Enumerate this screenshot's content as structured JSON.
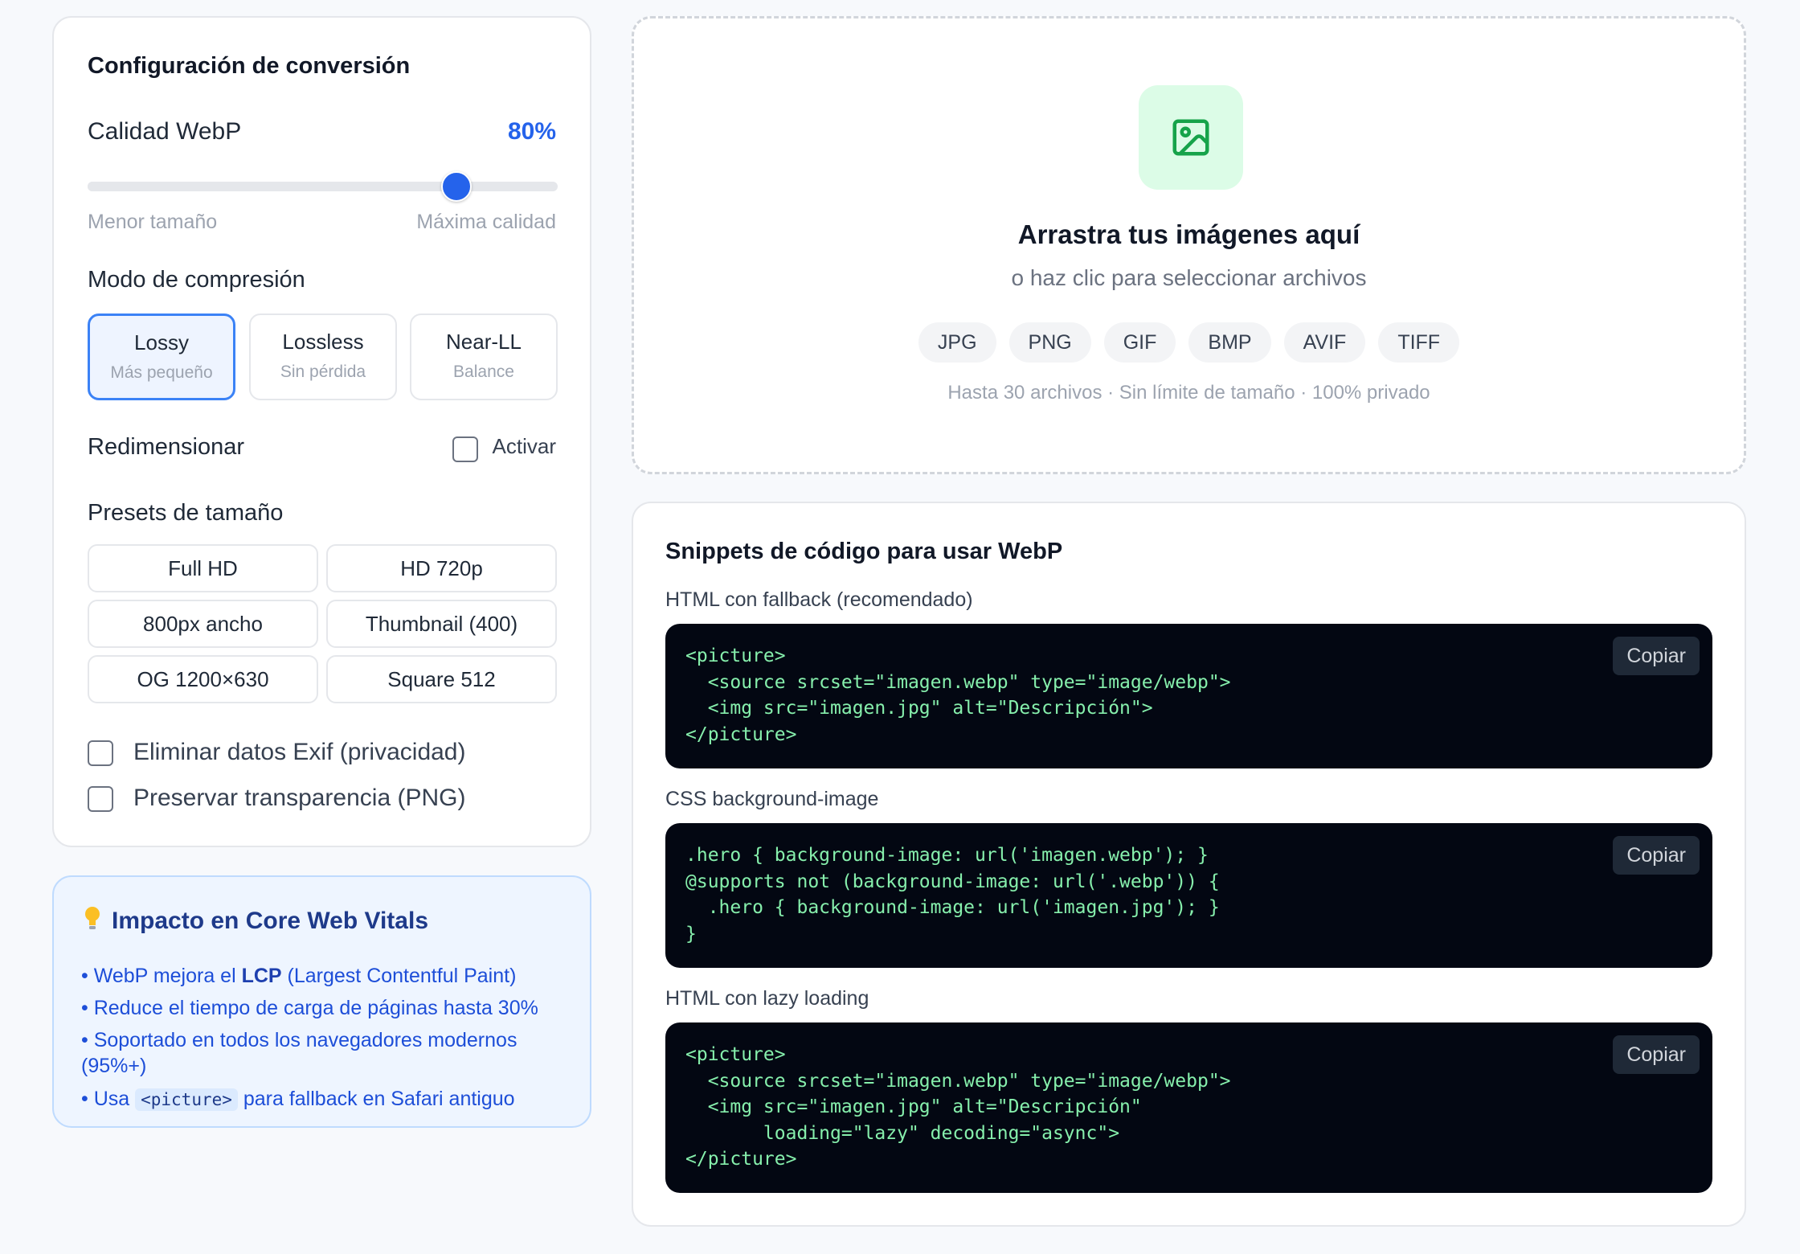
{
  "config": {
    "title": "Configuración de conversión",
    "quality": {
      "label": "Calidad WebP",
      "value_text": "80%",
      "value": 80,
      "min_hint": "Menor tamaño",
      "max_hint": "Máxima calidad"
    },
    "compression": {
      "label": "Modo de compresión",
      "modes": [
        {
          "title": "Lossy",
          "subtitle": "Más pequeño",
          "active": true
        },
        {
          "title": "Lossless",
          "subtitle": "Sin pérdida",
          "active": false
        },
        {
          "title": "Near-LL",
          "subtitle": "Balance",
          "active": false
        }
      ]
    },
    "resize": {
      "label": "Redimensionar",
      "toggle_label": "Activar",
      "checked": false
    },
    "presets": {
      "label": "Presets de tamaño",
      "items": [
        "Full HD",
        "HD 720p",
        "800px ancho",
        "Thumbnail (400)",
        "OG 1200×630",
        "Square 512"
      ]
    },
    "options": [
      {
        "label": "Eliminar datos Exif (privacidad)",
        "checked": false
      },
      {
        "label": "Preservar transparencia (PNG)",
        "checked": false
      }
    ]
  },
  "tips": {
    "icon": "lightbulb-icon",
    "title": "Impacto en Core Web Vitals",
    "items": {
      "lcp_pre": "• WebP mejora el ",
      "lcp_bold": "LCP",
      "lcp_post": " (Largest Contentful Paint)",
      "load": "• Reduce el tiempo de carga de páginas hasta 30%",
      "support": "• Soportado en todos los navegadores modernos (95%+)",
      "picture_pre": "• Usa ",
      "picture_code": "<picture>",
      "picture_post": " para fallback en Safari antiguo"
    }
  },
  "dropzone": {
    "icon": "image-icon",
    "title": "Arrastra tus imágenes aquí",
    "subtitle": "o haz clic para seleccionar archivos",
    "formats": [
      "JPG",
      "PNG",
      "GIF",
      "BMP",
      "AVIF",
      "TIFF"
    ],
    "note": "Hasta 30 archivos · Sin límite de tamaño · 100% privado"
  },
  "snippets": {
    "title": "Snippets de código para usar WebP",
    "copy_label": "Copiar",
    "items": [
      {
        "label": "HTML con fallback (recomendado)",
        "code": "<picture>\n  <source srcset=\"imagen.webp\" type=\"image/webp\">\n  <img src=\"imagen.jpg\" alt=\"Descripción\">\n</picture>"
      },
      {
        "label": "CSS background-image",
        "code": ".hero { background-image: url('imagen.webp'); }\n@supports not (background-image: url('.webp')) {\n  .hero { background-image: url('imagen.jpg'); }\n}"
      },
      {
        "label": "HTML con lazy loading",
        "code": "<picture>\n  <source srcset=\"imagen.webp\" type=\"image/webp\">\n  <img src=\"imagen.jpg\" alt=\"Descripción\"\n       loading=\"lazy\" decoding=\"async\">\n</picture>"
      }
    ]
  },
  "colors": {
    "accent": "#2563eb",
    "code_bg": "#030712",
    "code_text": "#86efac",
    "tips_bg": "#eef5ff",
    "dropzone_icon_bg": "#dcfce7"
  }
}
